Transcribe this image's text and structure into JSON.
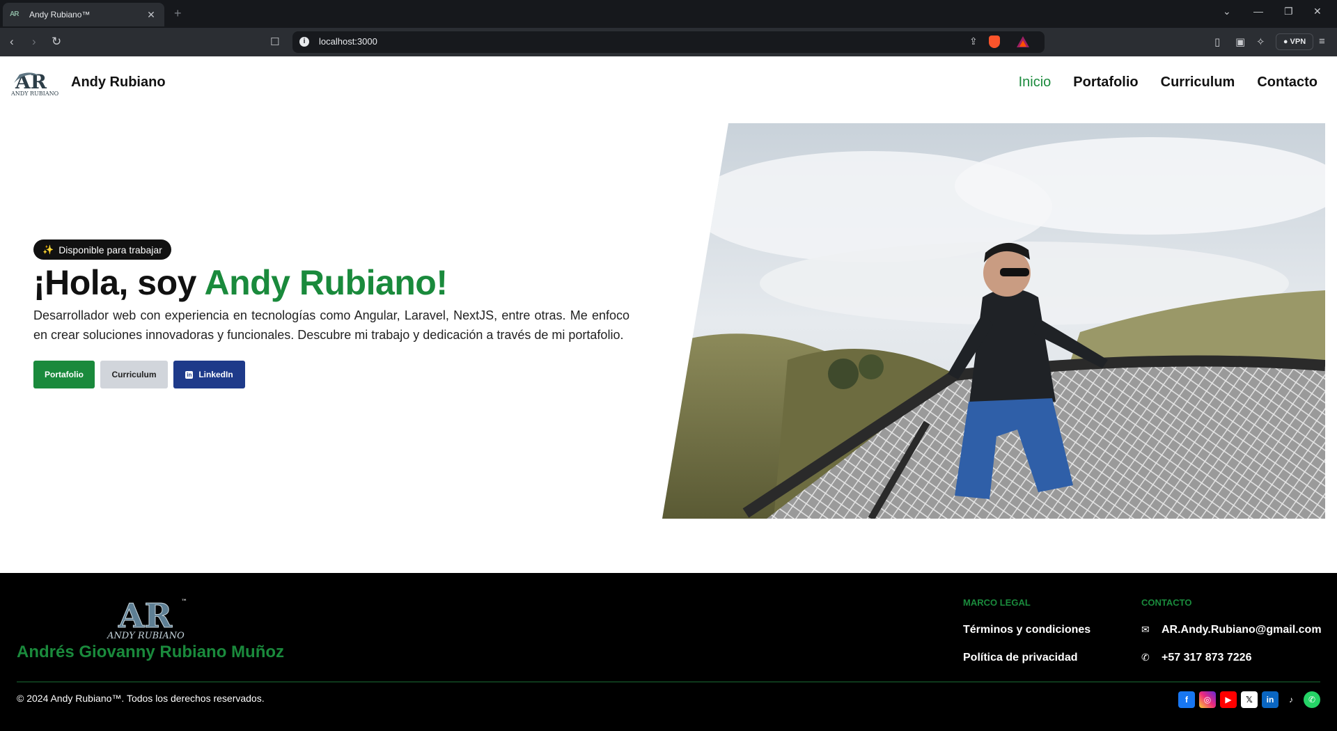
{
  "browser": {
    "tab_title": "Andy Rubiano™",
    "url": "localhost:3000",
    "vpn_label": "VPN"
  },
  "header": {
    "brand": "Andy Rubiano",
    "logo_text": "AR",
    "logo_sub": "ANDY RUBIANO",
    "nav": [
      {
        "label": "Inicio",
        "active": true
      },
      {
        "label": "Portafolio",
        "active": false
      },
      {
        "label": "Curriculum",
        "active": false
      },
      {
        "label": "Contacto",
        "active": false
      }
    ]
  },
  "hero": {
    "badge_icon": "✨",
    "badge": "Disponible para trabajar",
    "greeting": "¡Hola, soy ",
    "name": "Andy Rubiano!",
    "description": "Desarrollador web con experiencia en tecnologías como Angular, Laravel, NextJS, entre otras. Me enfoco en crear soluciones innovadoras y funcionales. Descubre mi trabajo y dedicación a través de mi portafolio.",
    "buttons": {
      "portfolio": "Portafolio",
      "cv": "Curriculum",
      "linkedin": "LinkedIn"
    }
  },
  "footer": {
    "logo_text": "AR",
    "logo_sub": "ANDY RUBIANO",
    "tm": "™",
    "full_name": "Andrés Giovanny Rubiano Muñoz",
    "legal": {
      "title": "MARCO LEGAL",
      "terms": "Términos y condiciones",
      "privacy": "Política de privacidad"
    },
    "contact": {
      "title": "CONTACTO",
      "email": "AR.Andy.Rubiano@gmail.com",
      "phone": "+57 317 873 7226"
    },
    "copyright": "© 2024 Andy Rubiano™. Todos los derechos reservados."
  },
  "colors": {
    "accent_green": "#1a8a3c",
    "linkedin_blue": "#1e3a8a",
    "footer_bg": "#000000"
  },
  "socials": [
    "facebook-icon",
    "instagram-icon",
    "youtube-icon",
    "x-icon",
    "linkedin-icon",
    "tiktok-icon",
    "whatsapp-icon"
  ]
}
